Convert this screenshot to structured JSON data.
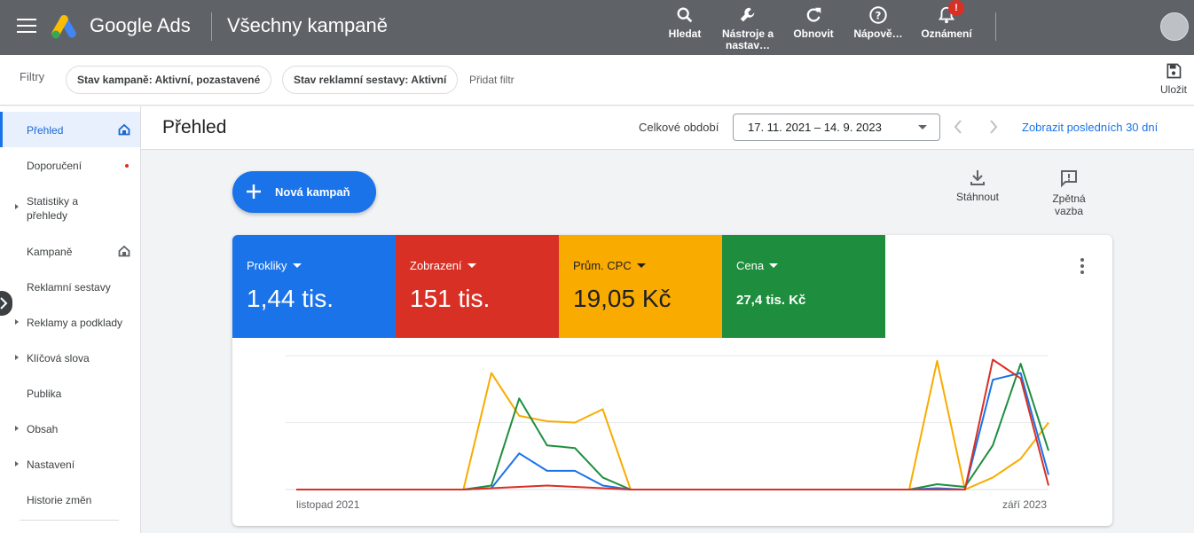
{
  "header": {
    "brand": "Google Ads",
    "page_title": "Všechny kampaně",
    "tools": [
      {
        "label": "Hledat",
        "icon": "search-icon"
      },
      {
        "label": "Nástroje a nastav…",
        "icon": "wrench-icon"
      },
      {
        "label": "Obnovit",
        "icon": "refresh-icon"
      },
      {
        "label": "Nápově…",
        "icon": "help-icon"
      },
      {
        "label": "Oznámení",
        "icon": "bell-icon",
        "badge": "!"
      }
    ]
  },
  "filters": {
    "label": "Filtry",
    "chips": [
      "Stav kampaně: Aktivní, pozastavené",
      "Stav reklamní sestavy: Aktivní"
    ],
    "add_filter": "Přidat filtr",
    "save": "Uložit"
  },
  "sidebar": {
    "items": [
      {
        "label": "Přehled",
        "active": true,
        "icon": "home-icon"
      },
      {
        "label": "Doporučení",
        "dot": true
      },
      {
        "label": "Statistiky a přehledy",
        "expandable": true
      },
      {
        "label": "Kampaně",
        "icon": "home-icon"
      },
      {
        "label": "Reklamní sestavy"
      },
      {
        "label": "Reklamy a podklady",
        "expandable": true
      },
      {
        "label": "Klíčová slova",
        "expandable": true
      },
      {
        "label": "Publika"
      },
      {
        "label": "Obsah",
        "expandable": true
      },
      {
        "label": "Nastavení",
        "expandable": true
      },
      {
        "label": "Historie změn"
      }
    ]
  },
  "page": {
    "title": "Přehled",
    "period_label": "Celkové období",
    "date_range": "17. 11. 2021 – 14. 9. 2023",
    "last30": "Zobrazit posledních 30 dní"
  },
  "main": {
    "new_campaign": "Nová kampaň",
    "download": "Stáhnout",
    "feedback": "Zpětná vazba"
  },
  "metrics": [
    {
      "name": "Prokliky",
      "value": "1,44 tis.",
      "color": "#1a73e8"
    },
    {
      "name": "Zobrazení",
      "value": "151 tis.",
      "color": "#d93025"
    },
    {
      "name": "Prům. CPC",
      "value": "19,05 Kč",
      "color": "#f9ab00"
    },
    {
      "name": "Cena",
      "value": "27,4 tis. Kč",
      "color": "#1e8e3e"
    }
  ],
  "chart_data": {
    "type": "line",
    "x_start_label": "listopad 2021",
    "x_end_label": "září 2023",
    "grid": true,
    "ylim": [
      0,
      1
    ],
    "series": [
      {
        "color": "#f9ab00",
        "values": [
          0,
          0,
          0,
          0,
          0,
          0,
          0,
          0.87,
          0.55,
          0.51,
          0.5,
          0.6,
          0,
          0,
          0,
          0,
          0,
          0,
          0,
          0,
          0,
          0,
          0,
          0.96,
          0,
          0.09,
          0.23,
          0.5
        ]
      },
      {
        "color": "#1e8e3e",
        "values": [
          0,
          0,
          0,
          0,
          0,
          0,
          0,
          0.03,
          0.68,
          0.33,
          0.31,
          0.09,
          0,
          0,
          0,
          0,
          0,
          0,
          0,
          0,
          0,
          0,
          0,
          0.04,
          0.02,
          0.33,
          0.94,
          0.29
        ]
      },
      {
        "color": "#1a73e8",
        "values": [
          0,
          0,
          0,
          0,
          0,
          0,
          0,
          0.01,
          0.27,
          0.14,
          0.14,
          0.03,
          0,
          0,
          0,
          0,
          0,
          0,
          0,
          0,
          0,
          0,
          0,
          0.01,
          0,
          0.82,
          0.87,
          0.11
        ]
      },
      {
        "color": "#d93025",
        "values": [
          0,
          0,
          0,
          0,
          0,
          0,
          0,
          0.01,
          0.02,
          0.03,
          0.02,
          0.01,
          0,
          0,
          0,
          0,
          0,
          0,
          0,
          0,
          0,
          0,
          0,
          0,
          0,
          0.97,
          0.83,
          0.03
        ]
      }
    ]
  }
}
